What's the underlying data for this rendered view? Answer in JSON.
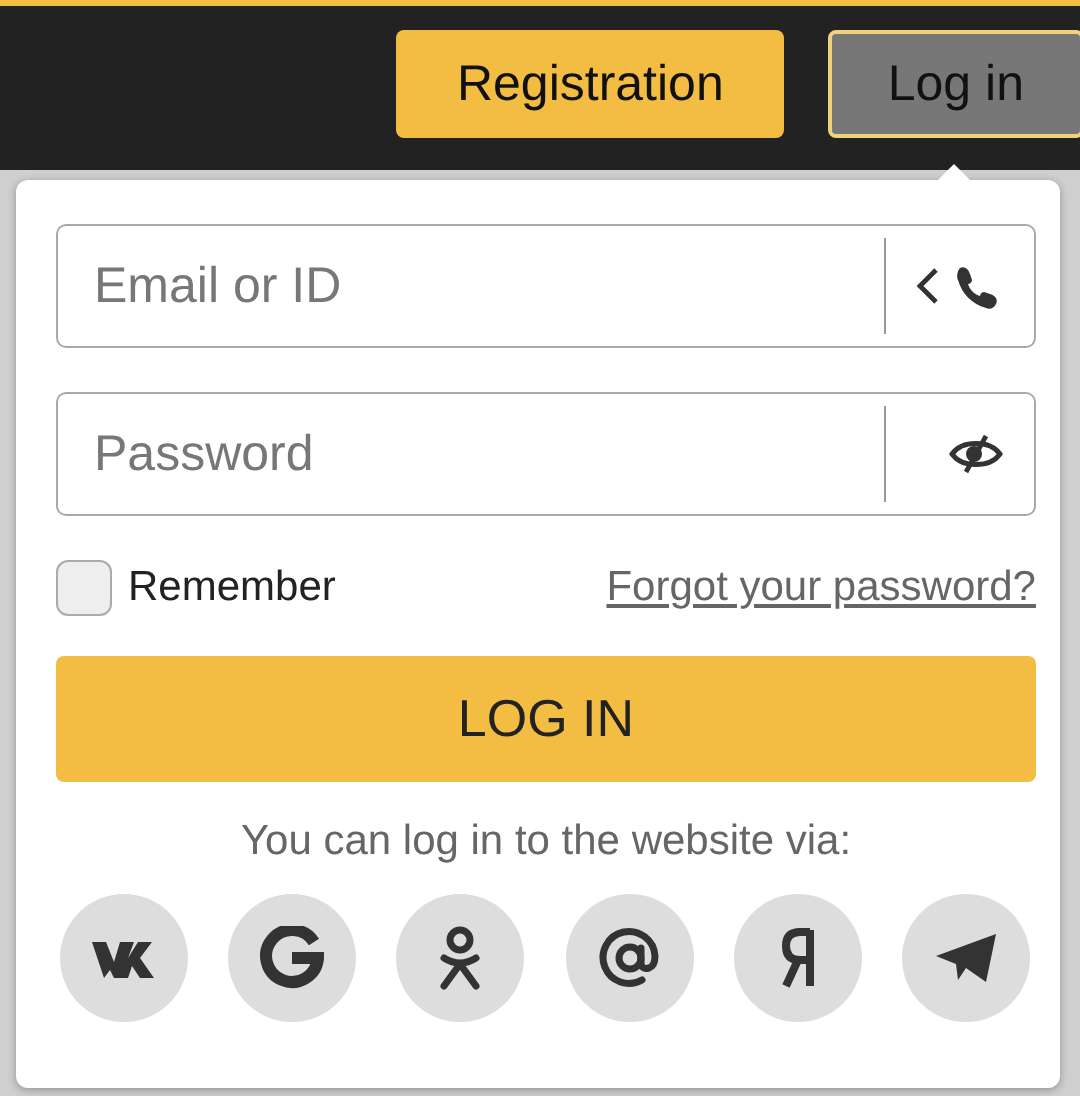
{
  "header": {
    "buttons": [
      {
        "label": "Registration",
        "selected": false
      },
      {
        "label": "Log in",
        "selected": true
      }
    ]
  },
  "login_form": {
    "fields": [
      {
        "kind": "login",
        "placeholder": "Email or ID"
      },
      {
        "kind": "password",
        "placeholder": "Password"
      }
    ],
    "remember": {
      "label": "Remember",
      "checked": false
    },
    "forgot_link": "Forgot your password?",
    "submit": "LOG IN",
    "social_caption": "You can log in to the website via:",
    "social": [
      {
        "kind": "vk"
      },
      {
        "kind": "google"
      },
      {
        "kind": "ok"
      },
      {
        "kind": "mail"
      },
      {
        "kind": "yandex"
      },
      {
        "kind": "telegram"
      }
    ]
  }
}
